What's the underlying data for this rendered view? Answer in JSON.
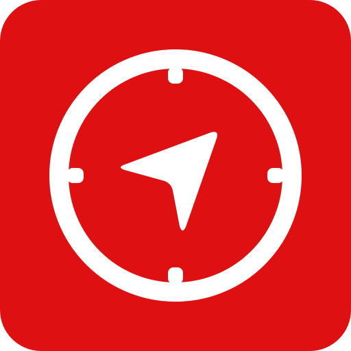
{
  "icon": {
    "name": "compass-navigation-app-icon",
    "background_color": "#DF1011",
    "foreground_color": "#FFFFFF",
    "symbol": "compass-with-navigation-arrow"
  }
}
